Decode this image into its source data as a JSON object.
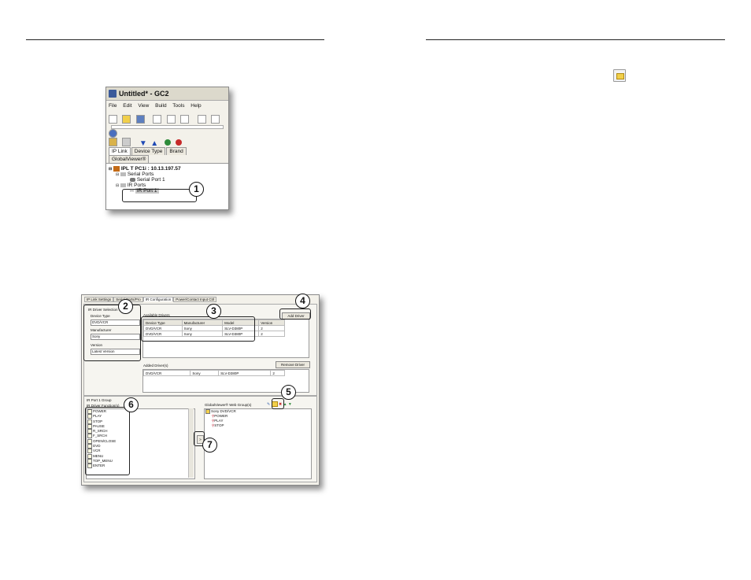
{
  "screenshot1": {
    "title": "Untitled* - GC2",
    "menu": [
      "File",
      "Edit",
      "View",
      "Build",
      "Tools",
      "Help"
    ],
    "tabs": [
      "IP Link",
      "Device Type",
      "Brand",
      "GlobalViewer®"
    ],
    "tree": {
      "root": "IPL T PC1i : 10.13.197.57",
      "serial_folder": "Serial Ports",
      "serial_port": "Serial Port 1",
      "ir_folder": "IR Ports",
      "ir_port": "IR Port 1"
    },
    "callout": "1"
  },
  "screenshot2": {
    "tabs": [
      "IP Link Settings",
      "Serial Ports/Pro",
      "IR Configuration",
      "Power/Contact Input Ctrl"
    ],
    "driver_selection": {
      "title": "IR Driver Selection",
      "device_type_label": "Device Type",
      "device_type_value": "DVD/VCR",
      "manufacturer_label": "Manufacturer",
      "manufacturer_value": "Sony",
      "version_label": "Version",
      "version_value": "Latest Version"
    },
    "available_drivers": {
      "title": "Available Drivers",
      "headers": [
        "Device Type",
        "Manufacturer",
        "Model",
        "Version"
      ],
      "rows": [
        [
          "DVD/VCR",
          "Sony",
          "SLV-D380P",
          "2"
        ],
        [
          "DVD/VCR",
          "Sony",
          "SLV-D380P",
          "2"
        ]
      ]
    },
    "add_driver_label": "Add Driver",
    "added_drivers": {
      "title": "Added Driver(s)",
      "rows": [
        [
          "DVD/VCR",
          "Sony",
          "SLV-D380P",
          "2"
        ]
      ]
    },
    "remove_driver_label": "Remove Driver",
    "group": {
      "title": "IR Port 1 Group",
      "functions_title": "IR Driver Function(s)",
      "functions": [
        "POWER",
        "PLAY",
        "STOP",
        "PAUSE",
        "R_SRCH",
        "F_SRCH",
        "OPEN/CLOSE",
        "DVD",
        "VCR",
        "MENU",
        "TOP_MENU",
        "ENTER"
      ],
      "gv_title": "GlobalViewer® Web Group(s)",
      "gv_root": "Sony DVD/VCR",
      "gv_items": [
        "POWER",
        "PLAY",
        "STOP"
      ],
      "move_arrow": ">"
    },
    "callouts": [
      "2",
      "3",
      "4",
      "5",
      "6",
      "7"
    ]
  },
  "colors": {
    "titlebar": "#dcd9cc",
    "panel": "#f3f1ea",
    "highlight": "#c9c9c9"
  }
}
